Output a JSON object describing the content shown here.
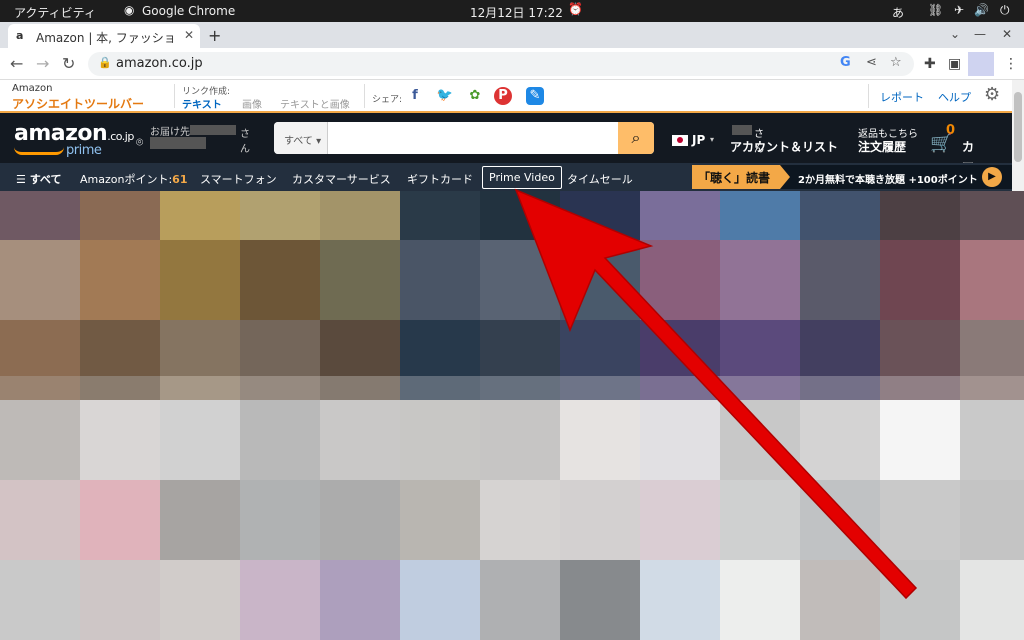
{
  "system_bar": {
    "activities": "アクティビティ",
    "app": "Google Chrome",
    "datetime": "12月12日  17:22",
    "ime": "あ"
  },
  "browser": {
    "tab_title": "Amazon | 本, ファッション, 家電から食品まで | アマゾン",
    "tab_favicon": "a",
    "url": "amazon.co.jp",
    "google_icon": "G"
  },
  "assoc_bar": {
    "brand_top": "Amazon",
    "brand_bottom": "アソシエイトツールバー",
    "link_label": "リンク作成:",
    "link_text": "テキスト",
    "link_image": "画像",
    "link_text_image": "テキストと画像",
    "share_label": "シェア:",
    "report": "レポート",
    "help": "ヘルプ"
  },
  "amazon_header": {
    "logo_main": "amazon",
    "logo_tld": ".co.jp",
    "logo_sub": "prime",
    "deliver_to": "お届け先",
    "san": "さん",
    "search_category": "すべて ▾",
    "lang": "JP",
    "account_top": "さん",
    "account_bottom": "アカウント＆リスト",
    "orders_top": "返品もこちら",
    "orders_bottom": "注文履歴",
    "cart_count": "0",
    "cart_label": "カート"
  },
  "amazon_nav": {
    "all": "すべて",
    "points_label": "Amazonポイント:",
    "points_value": "61",
    "smartphone": "スマートフォン",
    "customer_service": "カスタマーサービス",
    "gift_card": "ギフトカード",
    "prime_video": "Prime Video",
    "timesale": "タイムセール",
    "promo_kiku": "「聴く」読書",
    "promo_text": "2か月無料で本聴き放題 +100ポイント"
  },
  "colors": {
    "amazon_dark": "#131921",
    "amazon_nav": "#232f3e",
    "amazon_orange": "#f3a847",
    "annotation_arrow": "#e30000"
  },
  "mosaic_rows": [
    [
      "#6f5963",
      "#8a6a54",
      "#b89e5c",
      "#b1a170",
      "#a39469",
      "#2a3a48",
      "#22323f",
      "#2a3452",
      "#7a6e9a",
      "#4f7ba8",
      "#42536e",
      "#4d4044",
      "#5f4f55"
    ],
    [
      "#a68f7d",
      "#a27a55",
      "#93773f",
      "#6d5637",
      "#6f6b52",
      "#4a5566",
      "#596373",
      "#4a5a6c",
      "#8a5f7c",
      "#917396",
      "#5a5a6a",
      "#6f4651",
      "#a9767e"
    ],
    [
      "#8c6c52",
      "#715a44",
      "#857461",
      "#74665a",
      "#5a4a3d",
      "#27394b",
      "#34404f",
      "#3a4460",
      "#4a3d6a",
      "#5b4a7c",
      "#433f60",
      "#6a5258",
      "#8a7a78"
    ],
    [
      "#9a8370",
      "#8a7c6e",
      "#a69887",
      "#968a80",
      "#857a70",
      "#5e6a78",
      "#66707e",
      "#6e7488",
      "#7a6f92",
      "#85779a",
      "#747088",
      "#907f85",
      "#a2928f"
    ],
    [
      "#bebab7",
      "#d9d6d5",
      "#d1d1d1",
      "#b9b9b9",
      "#c9c8c7",
      "#c8c7c5",
      "#c6c5c4",
      "#e6e3e1",
      "#e1e0e3",
      "#c8c8c8",
      "#d4d3d3",
      "#f5f5f5",
      "#c9c9c9"
    ],
    [
      "#d3c3c5",
      "#e0b3bb",
      "#a7a4a2",
      "#b0b2b3",
      "#acacac",
      "#b9b6b1",
      "#d6d3d2",
      "#d3d0d0",
      "#dacdd3",
      "#cfd0d0",
      "#c0c2c4",
      "#c9c9c9",
      "#c4c4c4"
    ],
    [
      "#c9c9c9",
      "#cec6c6",
      "#d1ccca",
      "#c9b5c8",
      "#ad9fbd",
      "#c0cde0",
      "#afb0b2",
      "#878a8d",
      "#d1dbe6",
      "#edeeed",
      "#c1bcba",
      "#c5c6c6",
      "#e4e5e4"
    ]
  ]
}
